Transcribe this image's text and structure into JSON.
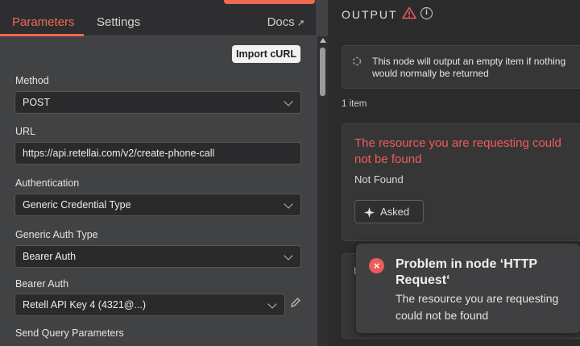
{
  "tabs": {
    "parameters": "Parameters",
    "settings": "Settings",
    "docs": "Docs",
    "docs_icon": "external-link-icon"
  },
  "import_curl": "Import cURL",
  "fields": {
    "method": {
      "label": "Method",
      "value": "POST"
    },
    "url": {
      "label": "URL",
      "value": "https://api.retellai.com/v2/create-phone-call"
    },
    "authentication": {
      "label": "Authentication",
      "value": "Generic Credential Type"
    },
    "generic_auth_type": {
      "label": "Generic Auth Type",
      "value": "Bearer Auth"
    },
    "bearer_auth": {
      "label": "Bearer Auth",
      "value": "Retell API Key 4 (4321@...)"
    },
    "send_query": {
      "label": "Send Query Parameters"
    }
  },
  "output": {
    "title": "OUTPUT",
    "notice": "This node will output an empty item if nothing would normally be returned",
    "items_count": "1 item",
    "error_title": "The resource you are requesting could not be found",
    "error_sub": "Not Found",
    "asked_label": "Asked",
    "under_card_letter": "I"
  },
  "toast": {
    "title": "Problem in node ‘HTTP Request‘",
    "message": "The resource you are requesting could not be found"
  },
  "colors": {
    "accent": "#ef6a50",
    "error": "#f15b5b"
  }
}
